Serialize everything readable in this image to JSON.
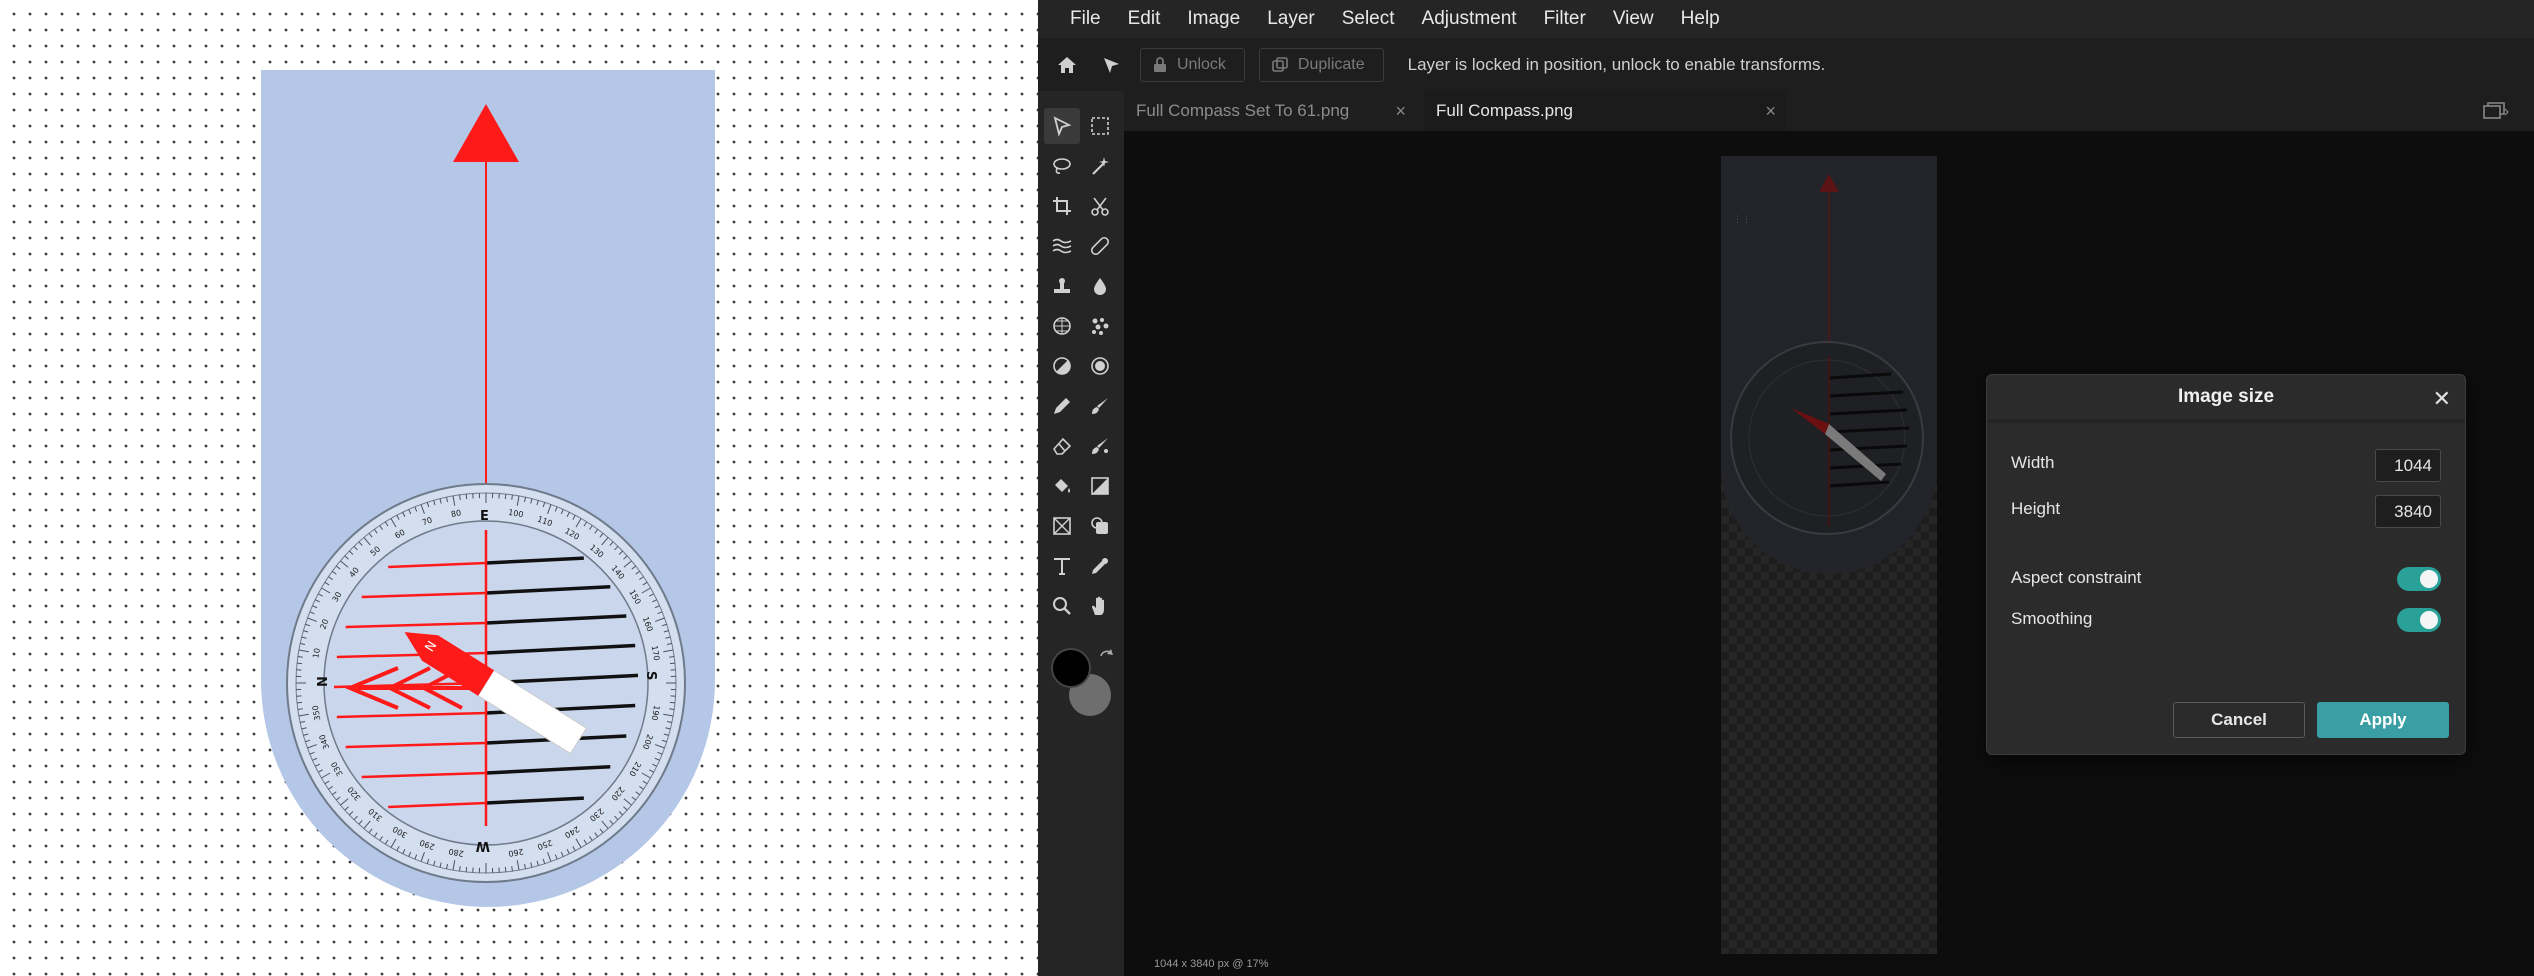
{
  "menu": [
    "File",
    "Edit",
    "Image",
    "Layer",
    "Select",
    "Adjustment",
    "Filter",
    "View",
    "Help"
  ],
  "toolbar": {
    "unlock_label": "Unlock",
    "duplicate_label": "Duplicate",
    "message": "Layer is locked in position, unlock to enable transforms."
  },
  "tabs": [
    {
      "label": "Full Compass Set To 61.png",
      "active": false
    },
    {
      "label": "Full Compass.png",
      "active": true
    }
  ],
  "status": "1044 x 3840 px @ 17%",
  "dialog": {
    "title": "Image size",
    "width_label": "Width",
    "width_value": "1044",
    "height_label": "Height",
    "height_value": "3840",
    "aspect_label": "Aspect constraint",
    "aspect_on": true,
    "smoothing_label": "Smoothing",
    "smoothing_on": true,
    "cancel_label": "Cancel",
    "apply_label": "Apply"
  },
  "compass": {
    "cardinals": {
      "N": "N",
      "E": "E",
      "S": "S",
      "W": "W"
    },
    "degree_labels": [
      "10",
      "20",
      "30",
      "40",
      "50",
      "60",
      "70",
      "80",
      "100",
      "110",
      "120",
      "130",
      "140",
      "150",
      "160",
      "170",
      "190",
      "200",
      "210",
      "220",
      "230",
      "240",
      "250",
      "260",
      "280",
      "290",
      "300",
      "310",
      "320",
      "330",
      "340",
      "350"
    ]
  },
  "colors": {
    "plate": "#b4c7e7",
    "red": "#ff1a1a",
    "accent": "#3a9fa4",
    "toggle": "#2aa198"
  }
}
